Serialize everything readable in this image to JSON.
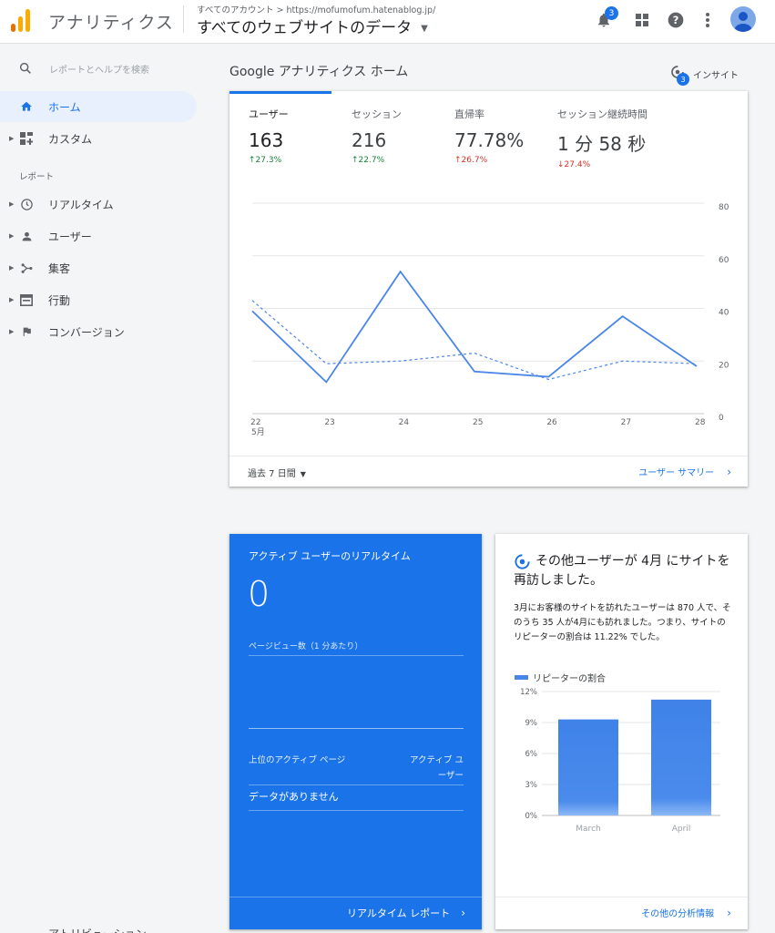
{
  "header": {
    "app_title": "アナリティクス",
    "breadcrumb_root": "すべてのアカウント",
    "breadcrumb_sep": ">",
    "breadcrumb_site": "https://mofumofum.hatenablog.jp/",
    "property_title": "すべてのウェブサイトのデータ",
    "notification_count": "3",
    "icons": [
      "bell-icon",
      "apps-grid-icon",
      "help-icon",
      "more-vert-icon",
      "avatar"
    ]
  },
  "sidebar": {
    "search_placeholder": "レポートとヘルプを検索",
    "items": [
      {
        "label": "ホーム",
        "icon": "home-icon",
        "active": true
      },
      {
        "label": "カスタム",
        "icon": "dashboard-icon"
      }
    ],
    "section_label": "レポート",
    "report_items": [
      {
        "label": "リアルタイム",
        "icon": "clock-icon"
      },
      {
        "label": "ユーザー",
        "icon": "person-icon"
      },
      {
        "label": "集客",
        "icon": "acquisition-icon"
      },
      {
        "label": "行動",
        "icon": "behavior-icon"
      },
      {
        "label": "コンバージョン",
        "icon": "flag-icon"
      }
    ],
    "cutoff_item": "アトリビューション"
  },
  "main": {
    "title": "Google アナリティクス ホーム",
    "insight_label": "インサイト",
    "insight_count": "3",
    "metrics": [
      {
        "label": "ユーザー",
        "value": "163",
        "change": "↑27.3%",
        "trend": "up-good"
      },
      {
        "label": "セッション",
        "value": "216",
        "change": "↑22.7%",
        "trend": "up-good"
      },
      {
        "label": "直帰率",
        "value": "77.78%",
        "change": "↑26.7%",
        "trend": "up-bad"
      },
      {
        "label": "セッション継続時間",
        "value": "1 分 58 秒",
        "change": "↓27.4%",
        "trend": "down-bad"
      }
    ],
    "date_range": "過去 7 日間",
    "summary_link": "ユーザー サマリー",
    "colors": {
      "accent": "#1a73e8",
      "line": "#4a86e8",
      "positive": "#188038",
      "negative": "#d93025"
    }
  },
  "chart_data": [
    {
      "type": "line",
      "x": [
        "22",
        "23",
        "24",
        "25",
        "26",
        "27",
        "28"
      ],
      "x_sub_label": "5月",
      "series": [
        {
          "style": "solid",
          "values": [
            39,
            12,
            54,
            16,
            14,
            37,
            18
          ]
        },
        {
          "style": "dashed",
          "values": [
            43,
            19,
            20,
            23,
            13,
            20,
            19
          ]
        }
      ],
      "y_ticks": [
        0,
        20,
        40,
        60,
        80
      ],
      "ylim": [
        0,
        80
      ]
    },
    {
      "type": "bar",
      "categories": [
        "March",
        "April"
      ],
      "values": [
        9.3,
        11.22
      ],
      "y_ticks": [
        "0%",
        "3%",
        "6%",
        "9%",
        "12%"
      ],
      "ylim": [
        0,
        12
      ],
      "legend": "リピーターの割合"
    }
  ],
  "realtime": {
    "title": "アクティブ ユーザーのリアルタイム",
    "value": "0",
    "subtitle": "ページビュー数（1 分あたり）",
    "col_pages": "上位のアクティブ ページ",
    "col_users": "アクティブ ユーザー",
    "empty": "データがありません",
    "link": "リアルタイム レポート"
  },
  "insight_card": {
    "title": "その他ユーザーが 4月 にサイトを再訪しました。",
    "body": "3月にお客様のサイトを訪れたユーザーは 870 人で、そのうち 35 人が4月にも訪れました。つまり、サイトのリピーターの割合は 11.22% でした。",
    "link": "その他の分析情報"
  }
}
